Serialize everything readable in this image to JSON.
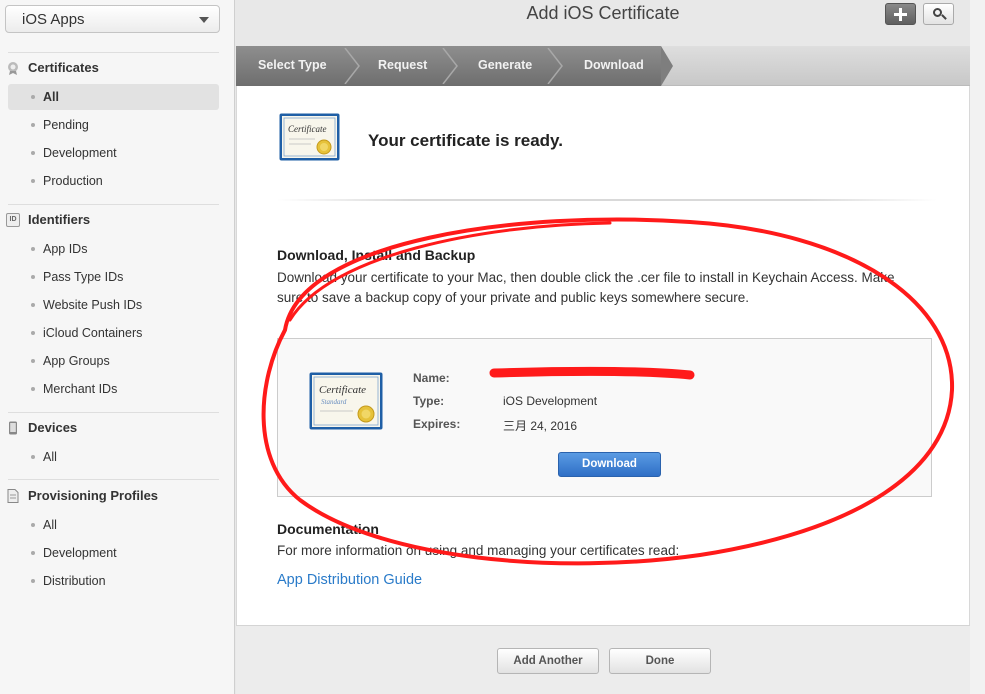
{
  "sidebar": {
    "app_selector": "iOS Apps",
    "sections": [
      {
        "title": "Certificates",
        "items": [
          "All",
          "Pending",
          "Development",
          "Production"
        ]
      },
      {
        "title": "Identifiers",
        "icon_text": "ID",
        "items": [
          "App IDs",
          "Pass Type IDs",
          "Website Push IDs",
          "iCloud Containers",
          "App Groups",
          "Merchant IDs"
        ]
      },
      {
        "title": "Devices",
        "items": [
          "All"
        ]
      },
      {
        "title": "Provisioning Profiles",
        "items": [
          "All",
          "Development",
          "Distribution"
        ]
      }
    ]
  },
  "header": {
    "title": "Add iOS Certificate"
  },
  "steps": [
    "Select Type",
    "Request",
    "Generate",
    "Download"
  ],
  "main": {
    "ready_text": "Your certificate is ready.",
    "download_heading": "Download, Install and Backup",
    "download_text": "Download your certificate to your Mac, then double click the .cer file to install in Keychain Access. Make sure to save a backup copy of your private and public keys somewhere secure.",
    "certificate": {
      "name_label": "Name:",
      "type_label": "Type:",
      "type_value": "iOS Development",
      "expires_label": "Expires:",
      "expires_value": "三月 24, 2016",
      "download_button": "Download"
    },
    "documentation_heading": "Documentation",
    "documentation_text": "For more information on using and managing your certificates read:",
    "documentation_link": "App Distribution Guide"
  },
  "footer": {
    "add_another": "Add Another",
    "done": "Done"
  },
  "colors": {
    "accent_blue": "#2f6fc6",
    "link": "#2a7bc9",
    "annotation_red": "#ff1a1a"
  }
}
